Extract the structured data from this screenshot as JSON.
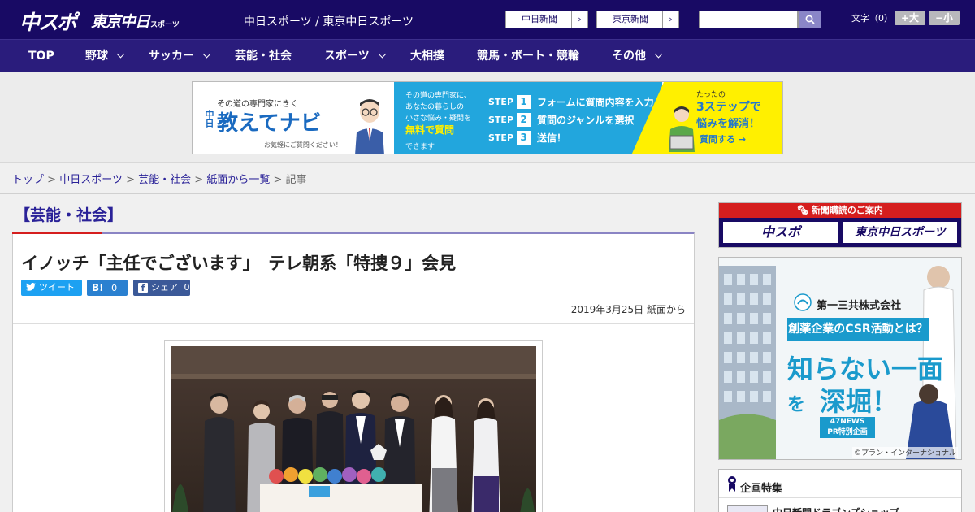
{
  "header": {
    "logo_main": "中スポ",
    "logo_sub": "東京中日",
    "logo_sub_suffix": "スポーツ",
    "site_links": "中日スポーツ / 東京中日スポーツ",
    "buttons": [
      "中日新聞",
      "東京新聞"
    ],
    "search_placeholder": "",
    "font_size_label": "文字（0）",
    "font_plus": "+大",
    "font_minus": "−小"
  },
  "nav": {
    "items": [
      {
        "label": "TOP",
        "dropdown": false
      },
      {
        "label": "野球",
        "dropdown": true
      },
      {
        "label": "サッカー",
        "dropdown": true
      },
      {
        "label": "芸能・社会",
        "dropdown": false
      },
      {
        "label": "スポーツ",
        "dropdown": true
      },
      {
        "label": "大相撲",
        "dropdown": false
      },
      {
        "label": "競馬・ボート・競輪",
        "dropdown": false
      },
      {
        "label": "その他",
        "dropdown": true
      }
    ]
  },
  "banner": {
    "tagline": "その道の専門家にきく",
    "brand_small": "中日",
    "brand": "教えてナビ",
    "note": "お気軽にご質問ください！",
    "mid_1": "その道の専門家に、",
    "mid_2": "あなたの暮らしの",
    "mid_3": "小さな悩み・疑問を",
    "mid_highlight": "無料で質問",
    "mid_4": "できます",
    "step_tag": "STEP",
    "steps": [
      {
        "num": "1",
        "text": "フォームに質問内容を入力"
      },
      {
        "num": "2",
        "text": "質問のジャンルを選択"
      },
      {
        "num": "3",
        "text": "送信！"
      }
    ],
    "right_1": "たったの",
    "right_2": "3ステップで",
    "right_3": "悩みを解消！",
    "right_cta": "質問する →"
  },
  "breadcrumb": {
    "items": [
      "トップ",
      "中日スポーツ",
      "芸能・社会",
      "紙面から一覧"
    ],
    "separator": ">",
    "current": "記事"
  },
  "main": {
    "category": "【芸能・社会】",
    "title": "イノッチ「主任でございます」　テレ朝系「特捜９」会見",
    "share": {
      "twitter": "ツイート",
      "hatena_label": "B!",
      "hatena_count": "0",
      "facebook_label": "シェア",
      "facebook_count": "0"
    },
    "date": "2019年3月25日 紙面から"
  },
  "sidebar": {
    "subscribe_heading": "新聞購読のご案内",
    "subscribe_logos": [
      "中スポ",
      "東京中日スポーツ"
    ],
    "ad": {
      "company": "第一三共株式会社",
      "headline": "創薬企業のCSR活動とは？",
      "big_1": "知らない一面",
      "big_1_suffix": "を",
      "big_2": "深堀！",
      "badge_1": "47NEWS",
      "badge_2": "PR特別企画",
      "credit": "©プラン・インターナショナル"
    },
    "feature_heading": "企画特集",
    "feature_item": "中日新聞ドラゴンズショップ"
  },
  "colors": {
    "header_bg": "#180a64",
    "nav_bg": "#2a1c7c",
    "accent_red": "#d51e1e",
    "link": "#2a2298",
    "banner_blue": "#22a6dd",
    "banner_yellow": "#fff000"
  }
}
